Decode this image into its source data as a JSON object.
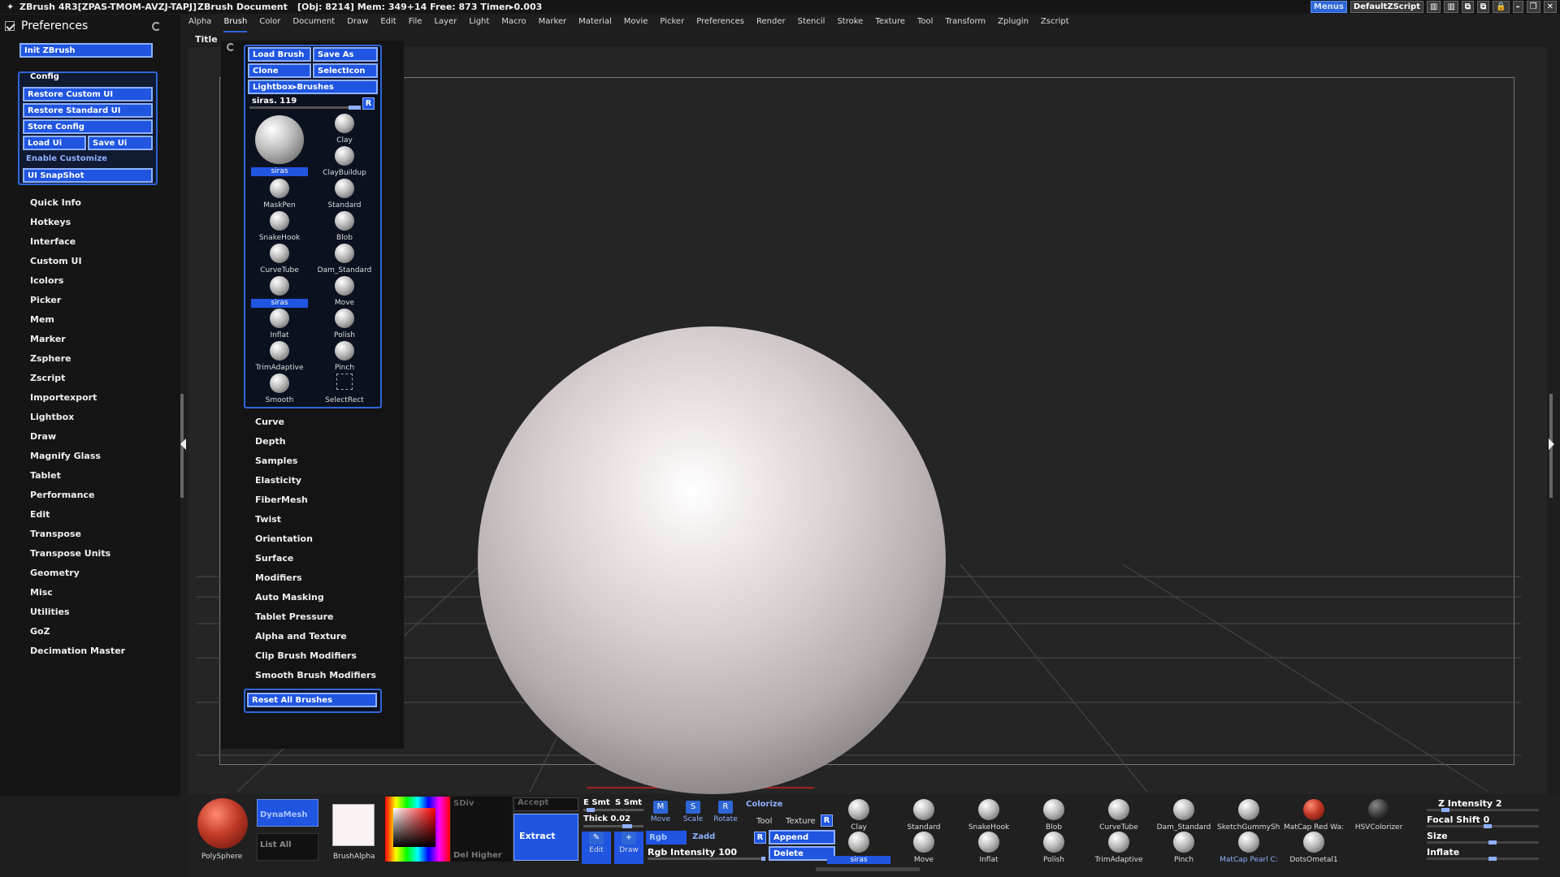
{
  "titlebar": {
    "app": "ZBrush 4R3[ZPAS-TMOM-AVZJ-TAPJ]",
    "doc": "ZBrush Document",
    "stats": "[Obj: 8214] Mem: 349+14 Free: 873 Timer▸0.003",
    "menus_btn": "Menus",
    "script_btn": "DefaultZScript"
  },
  "menubar": [
    "Alpha",
    "Brush",
    "Color",
    "Document",
    "Draw",
    "Edit",
    "File",
    "Layer",
    "Light",
    "Macro",
    "Marker",
    "Material",
    "Movie",
    "Picker",
    "Preferences",
    "Render",
    "Stencil",
    "Stroke",
    "Texture",
    "Tool",
    "Transform",
    "Zplugin",
    "Zscript"
  ],
  "prefs": {
    "title": "Preferences",
    "init": "Init ZBrush",
    "config_title": "Config",
    "restore_custom": "Restore Custom UI",
    "restore_standard": "Restore Standard UI",
    "store_config": "Store Config",
    "load_ui": "Load Ui",
    "save_ui": "Save Ui",
    "enable_customize": "Enable Customize",
    "ui_snapshot": "UI SnapShot",
    "items": [
      "Quick Info",
      "Hotkeys",
      "Interface",
      "Custom UI",
      "Icolors",
      "Picker",
      "Mem",
      "Marker",
      "Zsphere",
      "Zscript",
      "Importexport",
      "Lightbox",
      "Draw",
      "Magnify Glass",
      "Tablet",
      "Performance",
      "Edit",
      "Transpose",
      "Transpose Units",
      "Geometry",
      "Misc",
      "Utilities",
      "GoZ",
      "Decimation Master"
    ]
  },
  "document": {
    "title": "Title"
  },
  "brush": {
    "load": "Load Brush",
    "save_as": "Save As",
    "clone": "Clone",
    "select_icon": "SelectIcon",
    "lightbox": "Lightbox▸Brushes",
    "slider": "siras. 119",
    "r": "R",
    "brushes": [
      "siras",
      "Clay",
      "ClayBuildup",
      "MaskPen",
      "Standard",
      "SnakeHook",
      "Blob",
      "CurveTube",
      "Dam_Standard",
      "siras",
      "Move",
      "Inflat",
      "Polish",
      "TrimAdaptive",
      "Pinch",
      "Smooth",
      "SelectRect"
    ],
    "sections": [
      "Curve",
      "Depth",
      "Samples",
      "Elasticity",
      "FiberMesh",
      "Twist",
      "Orientation",
      "Surface",
      "Modifiers",
      "Auto Masking",
      "Tablet Pressure",
      "Alpha and Texture",
      "Clip Brush Modifiers",
      "Smooth Brush Modifiers"
    ],
    "reset": "Reset All Brushes"
  },
  "bottom": {
    "polysphere": "PolySphere",
    "dynamesh": "DynaMesh",
    "list_all": "List All",
    "brush_alpha": "BrushAlpha",
    "sdiv": "SDiv",
    "del_higher": "Del Higher",
    "accept": "Accept",
    "extract": "Extract",
    "e_smt": "E Smt",
    "s_smt": "S Smt",
    "thick": "Thick 0.02",
    "move": "Move",
    "scale": "Scale",
    "rotate": "Rotate",
    "edit": "Edit",
    "draw": "Draw",
    "colorize": "Colorize",
    "tool": "Tool",
    "texture": "Texture",
    "r": "R",
    "rgb": "Rgb",
    "zadd": "Zadd",
    "append": "Append",
    "delete": "Delete",
    "rgb_intensity": "Rgb Intensity 100",
    "shelf_top": [
      "Clay",
      "Standard",
      "SnakeHook",
      "Blob",
      "CurveTube",
      "Dam_Standard",
      "SketchGummyShi",
      "MatCap Red Wa:",
      "HSVColorizer"
    ],
    "shelf_bottom": [
      "siras",
      "Move",
      "Inflat",
      "Polish",
      "TrimAdaptive",
      "Pinch",
      "MatCap Pearl C:",
      "DotsOmetal1"
    ],
    "z_intensity": "Z Intensity 2",
    "focal_shift": "Focal Shift 0",
    "size": "Size",
    "inflate": "Inflate"
  }
}
